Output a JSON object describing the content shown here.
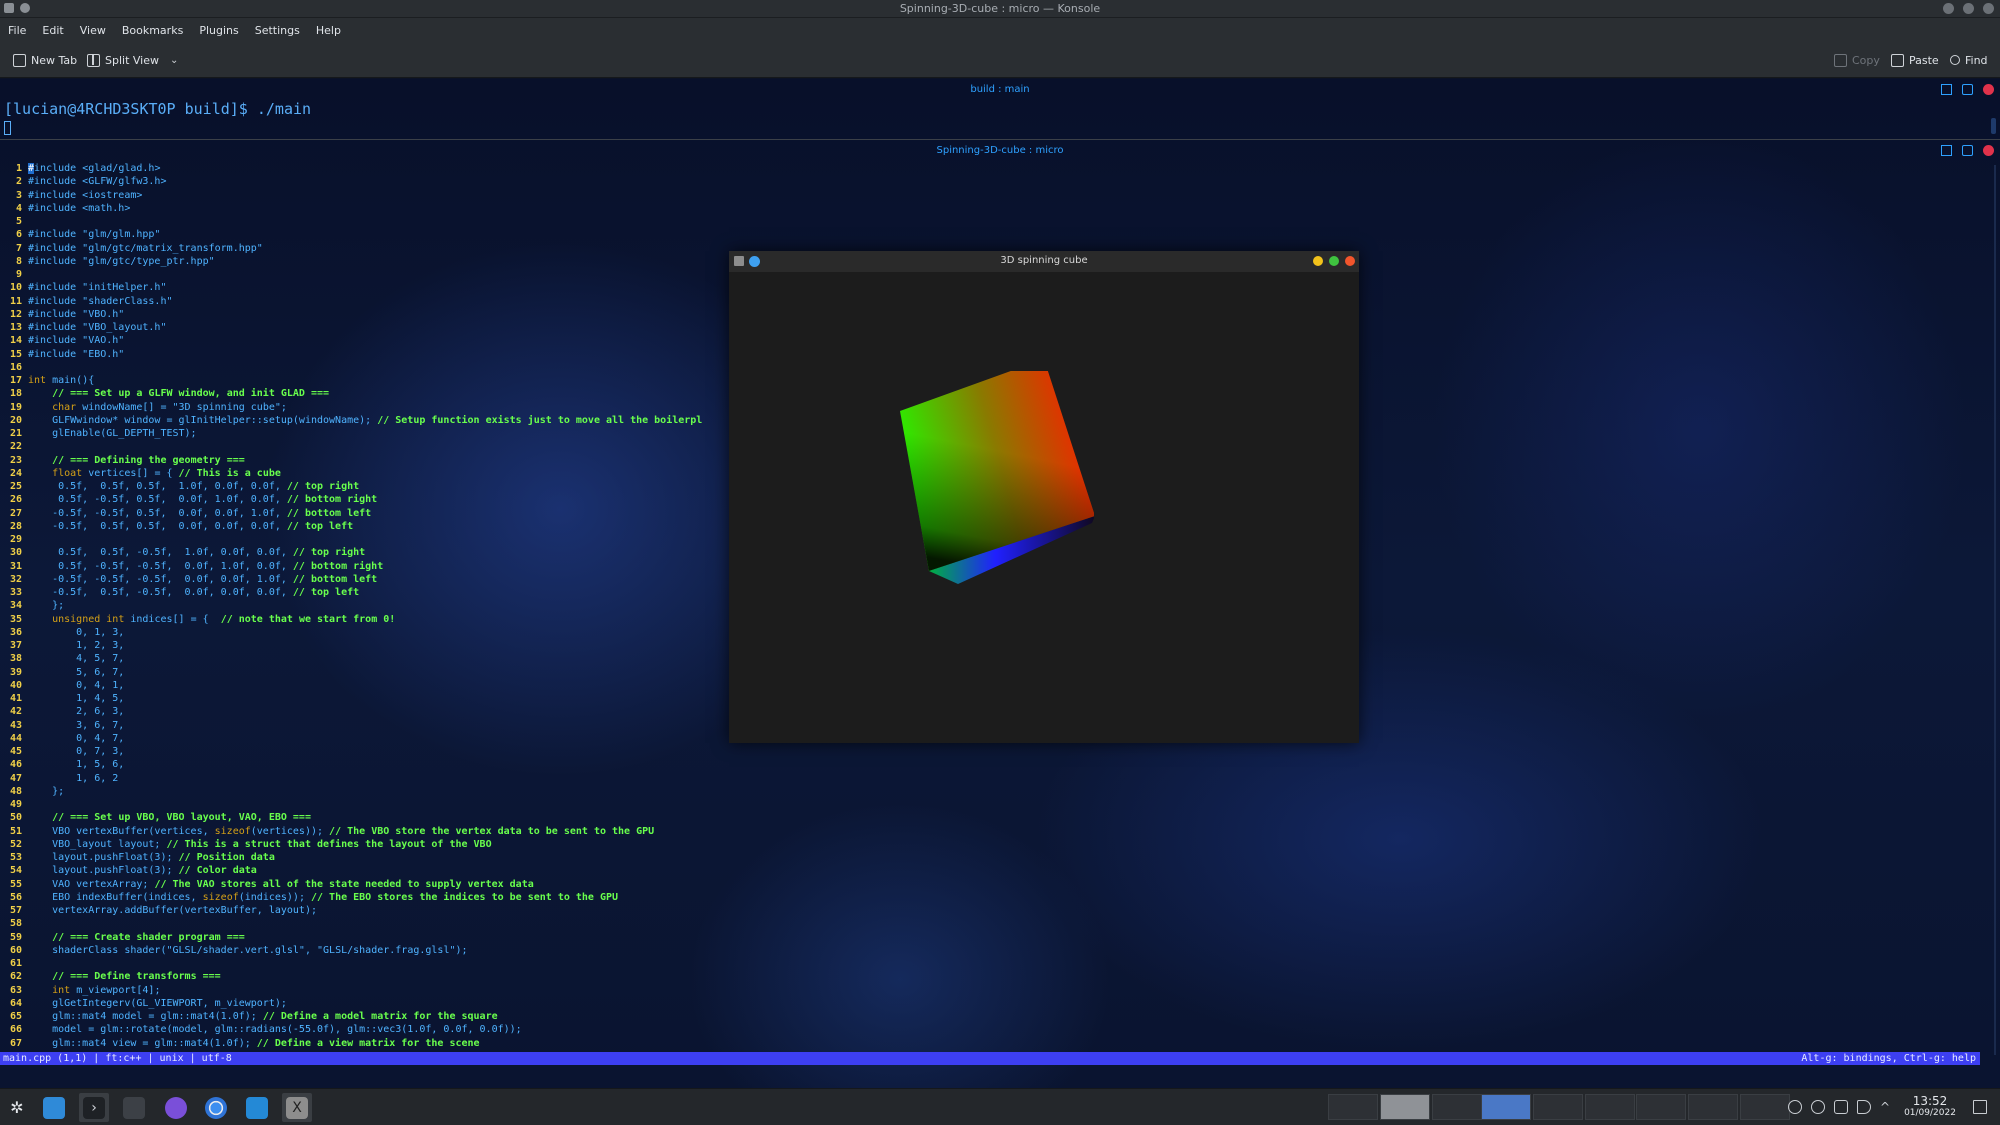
{
  "window": {
    "title": "Spinning-3D-cube : micro — Konsole"
  },
  "menu": [
    "File",
    "Edit",
    "View",
    "Bookmarks",
    "Plugins",
    "Settings",
    "Help"
  ],
  "toolbar": {
    "new_tab": "New Tab",
    "split_view": "Split View",
    "copy": "Copy",
    "paste": "Paste",
    "find": "Find"
  },
  "pane_top": {
    "title": "build : main",
    "prompt": "[lucian@4RCHD3SKT0P build]$ ./main"
  },
  "pane_bottom": {
    "title": "Spinning-3D-cube : micro"
  },
  "code_lines": [
    {
      "n": "1",
      "segs": [
        [
          "cursor",
          "#"
        ],
        [
          "pp",
          "include <glad/glad.h>"
        ]
      ]
    },
    {
      "n": "2",
      "segs": [
        [
          "pp",
          "#include <GLFW/glfw3.h>"
        ]
      ]
    },
    {
      "n": "3",
      "segs": [
        [
          "pp",
          "#include <iostream>"
        ]
      ]
    },
    {
      "n": "4",
      "segs": [
        [
          "pp",
          "#include <math.h>"
        ]
      ]
    },
    {
      "n": "5",
      "segs": []
    },
    {
      "n": "6",
      "segs": [
        [
          "pp",
          "#include \"glm/glm.hpp\""
        ]
      ]
    },
    {
      "n": "7",
      "segs": [
        [
          "pp",
          "#include \"glm/gtc/matrix_transform.hpp\""
        ]
      ]
    },
    {
      "n": "8",
      "segs": [
        [
          "pp",
          "#include \"glm/gtc/type_ptr.hpp\""
        ]
      ]
    },
    {
      "n": "9",
      "segs": []
    },
    {
      "n": "10",
      "segs": [
        [
          "pp",
          "#include \"initHelper.h\""
        ]
      ]
    },
    {
      "n": "11",
      "segs": [
        [
          "pp",
          "#include \"shaderClass.h\""
        ]
      ]
    },
    {
      "n": "12",
      "segs": [
        [
          "pp",
          "#include \"VBO.h\""
        ]
      ]
    },
    {
      "n": "13",
      "segs": [
        [
          "pp",
          "#include \"VBO_layout.h\""
        ]
      ]
    },
    {
      "n": "14",
      "segs": [
        [
          "pp",
          "#include \"VAO.h\""
        ]
      ]
    },
    {
      "n": "15",
      "segs": [
        [
          "pp",
          "#include \"EBO.h\""
        ]
      ]
    },
    {
      "n": "16",
      "segs": []
    },
    {
      "n": "17",
      "segs": [
        [
          "type",
          "int "
        ],
        [
          "norm",
          "main(){"
        ]
      ]
    },
    {
      "n": "18",
      "segs": [
        [
          "norm",
          "    "
        ],
        [
          "cm",
          "// === Set up a GLFW window, and init GLAD ==="
        ]
      ]
    },
    {
      "n": "19",
      "segs": [
        [
          "norm",
          "    "
        ],
        [
          "type",
          "char "
        ],
        [
          "norm",
          "windowName[] = "
        ],
        [
          "str",
          "\"3D spinning cube\""
        ],
        [
          "norm",
          ";"
        ]
      ]
    },
    {
      "n": "20",
      "segs": [
        [
          "norm",
          "    GLFWwindow* window = glInitHelper::setup(windowName); "
        ],
        [
          "cm",
          "// Setup function exists just to move all the boilerpl"
        ]
      ]
    },
    {
      "n": "21",
      "segs": [
        [
          "norm",
          "    glEnable(GL_DEPTH_TEST);"
        ]
      ]
    },
    {
      "n": "22",
      "segs": []
    },
    {
      "n": "23",
      "segs": [
        [
          "norm",
          "    "
        ],
        [
          "cm",
          "// === Defining the geometry ==="
        ]
      ]
    },
    {
      "n": "24",
      "segs": [
        [
          "norm",
          "    "
        ],
        [
          "type",
          "float "
        ],
        [
          "norm",
          "vertices[] = { "
        ],
        [
          "cm",
          "// This is a cube"
        ]
      ]
    },
    {
      "n": "25",
      "segs": [
        [
          "norm",
          "     0.5f,  0.5f, 0.5f,  1.0f, 0.0f, 0.0f, "
        ],
        [
          "cm",
          "// top right"
        ]
      ]
    },
    {
      "n": "26",
      "segs": [
        [
          "norm",
          "     0.5f, -0.5f, 0.5f,  0.0f, 1.0f, 0.0f, "
        ],
        [
          "cm",
          "// bottom right"
        ]
      ]
    },
    {
      "n": "27",
      "segs": [
        [
          "norm",
          "    -0.5f, -0.5f, 0.5f,  0.0f, 0.0f, 1.0f, "
        ],
        [
          "cm",
          "// bottom left"
        ]
      ]
    },
    {
      "n": "28",
      "segs": [
        [
          "norm",
          "    -0.5f,  0.5f, 0.5f,  0.0f, 0.0f, 0.0f, "
        ],
        [
          "cm",
          "// top left"
        ]
      ]
    },
    {
      "n": "29",
      "segs": []
    },
    {
      "n": "30",
      "segs": [
        [
          "norm",
          "     0.5f,  0.5f, -0.5f,  1.0f, 0.0f, 0.0f, "
        ],
        [
          "cm",
          "// top right"
        ]
      ]
    },
    {
      "n": "31",
      "segs": [
        [
          "norm",
          "     0.5f, -0.5f, -0.5f,  0.0f, 1.0f, 0.0f, "
        ],
        [
          "cm",
          "// bottom right"
        ]
      ]
    },
    {
      "n": "32",
      "segs": [
        [
          "norm",
          "    -0.5f, -0.5f, -0.5f,  0.0f, 0.0f, 1.0f, "
        ],
        [
          "cm",
          "// bottom left"
        ]
      ]
    },
    {
      "n": "33",
      "segs": [
        [
          "norm",
          "    -0.5f,  0.5f, -0.5f,  0.0f, 0.0f, 0.0f, "
        ],
        [
          "cm",
          "// top left"
        ]
      ]
    },
    {
      "n": "34",
      "segs": [
        [
          "norm",
          "    };"
        ]
      ]
    },
    {
      "n": "35",
      "segs": [
        [
          "norm",
          "    "
        ],
        [
          "type",
          "unsigned int "
        ],
        [
          "norm",
          "indices[] = {  "
        ],
        [
          "cm",
          "// note that we start from 0!"
        ]
      ]
    },
    {
      "n": "36",
      "segs": [
        [
          "norm",
          "        0, 1, 3,"
        ]
      ]
    },
    {
      "n": "37",
      "segs": [
        [
          "norm",
          "        1, 2, 3,"
        ]
      ]
    },
    {
      "n": "38",
      "segs": [
        [
          "norm",
          "        4, 5, 7,"
        ]
      ]
    },
    {
      "n": "39",
      "segs": [
        [
          "norm",
          "        5, 6, 7,"
        ]
      ]
    },
    {
      "n": "40",
      "segs": [
        [
          "norm",
          "        0, 4, 1,"
        ]
      ]
    },
    {
      "n": "41",
      "segs": [
        [
          "norm",
          "        1, 4, 5,"
        ]
      ]
    },
    {
      "n": "42",
      "segs": [
        [
          "norm",
          "        2, 6, 3,"
        ]
      ]
    },
    {
      "n": "43",
      "segs": [
        [
          "norm",
          "        3, 6, 7,"
        ]
      ]
    },
    {
      "n": "44",
      "segs": [
        [
          "norm",
          "        0, 4, 7,"
        ]
      ]
    },
    {
      "n": "45",
      "segs": [
        [
          "norm",
          "        0, 7, 3,"
        ]
      ]
    },
    {
      "n": "46",
      "segs": [
        [
          "norm",
          "        1, 5, 6,"
        ]
      ]
    },
    {
      "n": "47",
      "segs": [
        [
          "norm",
          "        1, 6, 2"
        ]
      ]
    },
    {
      "n": "48",
      "segs": [
        [
          "norm",
          "    };"
        ]
      ]
    },
    {
      "n": "49",
      "segs": []
    },
    {
      "n": "50",
      "segs": [
        [
          "norm",
          "    "
        ],
        [
          "cm",
          "// === Set up VBO, VBO layout, VAO, EBO ==="
        ]
      ]
    },
    {
      "n": "51",
      "segs": [
        [
          "norm",
          "    VBO vertexBuffer(vertices, "
        ],
        [
          "type",
          "sizeof"
        ],
        [
          "norm",
          "(vertices)); "
        ],
        [
          "cm",
          "// The VBO store the vertex data to be sent to the GPU"
        ]
      ]
    },
    {
      "n": "52",
      "segs": [
        [
          "norm",
          "    VBO_layout layout; "
        ],
        [
          "cm",
          "// This is a struct that defines the layout of the VBO"
        ]
      ]
    },
    {
      "n": "53",
      "segs": [
        [
          "norm",
          "    layout.pushFloat(3); "
        ],
        [
          "cm",
          "// Position data"
        ]
      ]
    },
    {
      "n": "54",
      "segs": [
        [
          "norm",
          "    layout.pushFloat(3); "
        ],
        [
          "cm",
          "// Color data"
        ]
      ]
    },
    {
      "n": "55",
      "segs": [
        [
          "norm",
          "    VAO vertexArray; "
        ],
        [
          "cm",
          "// The VAO stores all of the state needed to supply vertex data"
        ]
      ]
    },
    {
      "n": "56",
      "segs": [
        [
          "norm",
          "    EBO indexBuffer(indices, "
        ],
        [
          "type",
          "sizeof"
        ],
        [
          "norm",
          "(indices)); "
        ],
        [
          "cm",
          "// The EBO stores the indices to be sent to the GPU"
        ]
      ]
    },
    {
      "n": "57",
      "segs": [
        [
          "norm",
          "    vertexArray.addBuffer(vertexBuffer, layout);"
        ]
      ]
    },
    {
      "n": "58",
      "segs": []
    },
    {
      "n": "59",
      "segs": [
        [
          "norm",
          "    "
        ],
        [
          "cm",
          "// === Create shader program ==="
        ]
      ]
    },
    {
      "n": "60",
      "segs": [
        [
          "norm",
          "    shaderClass shader("
        ],
        [
          "str",
          "\"GLSL/shader.vert.glsl\""
        ],
        [
          "norm",
          ", "
        ],
        [
          "str",
          "\"GLSL/shader.frag.glsl\""
        ],
        [
          "norm",
          ");"
        ]
      ]
    },
    {
      "n": "61",
      "segs": []
    },
    {
      "n": "62",
      "segs": [
        [
          "norm",
          "    "
        ],
        [
          "cm",
          "// === Define transforms ==="
        ]
      ]
    },
    {
      "n": "63",
      "segs": [
        [
          "norm",
          "    "
        ],
        [
          "type",
          "int "
        ],
        [
          "norm",
          "m_viewport[4];"
        ]
      ]
    },
    {
      "n": "64",
      "segs": [
        [
          "norm",
          "    glGetIntegerv(GL_VIEWPORT, m_viewport);"
        ]
      ]
    },
    {
      "n": "65",
      "segs": [
        [
          "norm",
          "    glm::mat4 model = glm::mat4(1.0f); "
        ],
        [
          "cm",
          "// Define a model matrix for the square"
        ]
      ]
    },
    {
      "n": "66",
      "segs": [
        [
          "norm",
          "    model = glm::rotate(model, glm::radians(-55.0f), glm::vec3(1.0f, 0.0f, 0.0f));"
        ]
      ]
    },
    {
      "n": "67",
      "segs": [
        [
          "norm",
          "    glm::mat4 view = glm::mat4(1.0f); "
        ],
        [
          "cm",
          "// Define a view matrix for the scene"
        ]
      ]
    }
  ],
  "statusbar": {
    "left": "main.cpp (1,1) | ft:c++ | unix | utf-8",
    "right": "Alt-g: bindings, Ctrl-g: help"
  },
  "gl_window": {
    "title": "3D spinning cube"
  },
  "taskbar": {
    "time": "13:52",
    "date": "01/09/2022"
  },
  "colors": {
    "accent": "#2ea1ff",
    "status_bar": "#3d3ff2",
    "line_numbers": "#f0d048",
    "comments": "#69ff4d"
  }
}
